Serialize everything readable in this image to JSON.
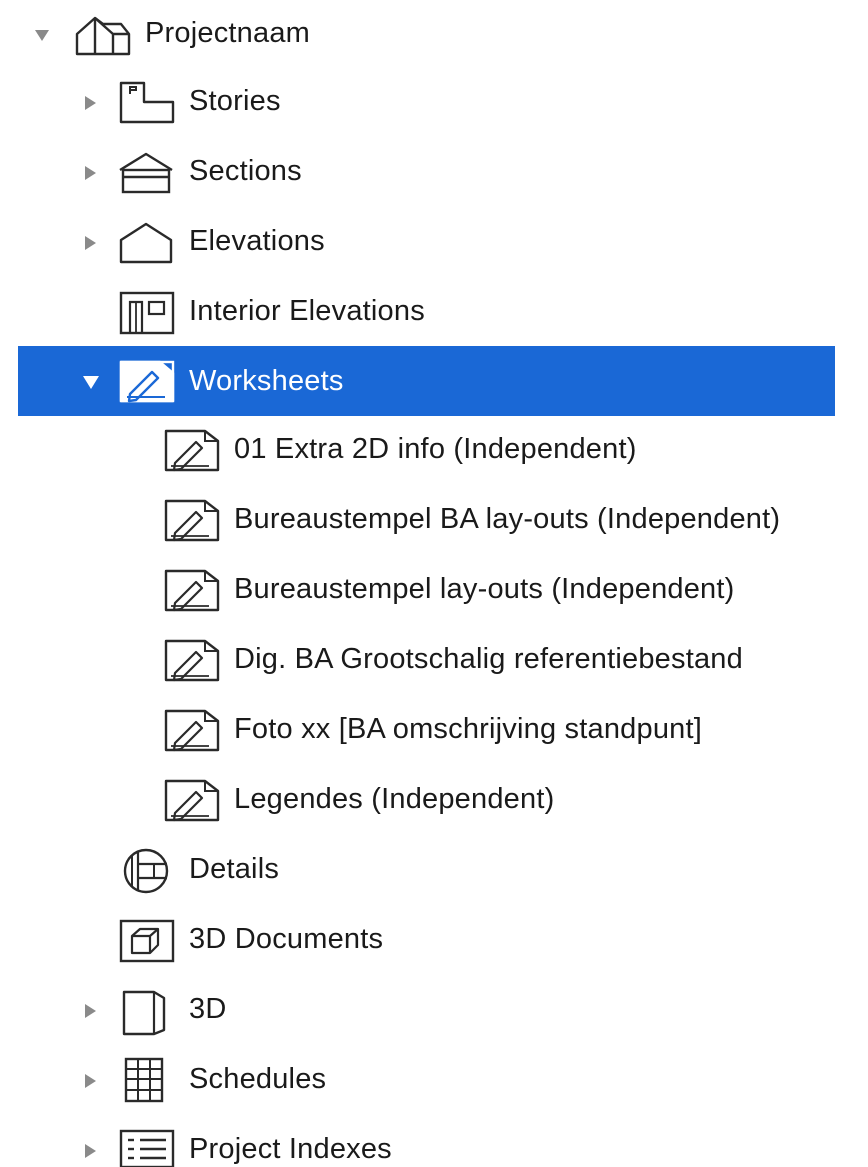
{
  "tree": {
    "root": {
      "label": "Projectnaam",
      "icon": "project-house-icon",
      "expanded": true
    },
    "items": [
      {
        "label": "Stories",
        "icon": "stories-icon",
        "disclosure": "collapsed"
      },
      {
        "label": "Sections",
        "icon": "sections-icon",
        "disclosure": "collapsed"
      },
      {
        "label": "Elevations",
        "icon": "elevations-icon",
        "disclosure": "collapsed"
      },
      {
        "label": "Interior Elevations",
        "icon": "interior-elevations-icon",
        "disclosure": "none"
      },
      {
        "label": "Worksheets",
        "icon": "worksheet-icon",
        "disclosure": "expanded",
        "selected": true
      },
      {
        "label": "Details",
        "icon": "details-icon",
        "disclosure": "none"
      },
      {
        "label": "3D Documents",
        "icon": "3d-documents-icon",
        "disclosure": "none"
      },
      {
        "label": "3D",
        "icon": "3d-icon",
        "disclosure": "collapsed"
      },
      {
        "label": "Schedules",
        "icon": "schedules-icon",
        "disclosure": "collapsed"
      },
      {
        "label": "Project Indexes",
        "icon": "project-indexes-icon",
        "disclosure": "collapsed"
      }
    ],
    "worksheets": [
      {
        "label": "01 Extra 2D info (Independent)",
        "icon": "worksheet-icon"
      },
      {
        "label": "Bureaustempel BA lay-outs (Independent)",
        "icon": "worksheet-icon"
      },
      {
        "label": "Bureaustempel lay-outs (Independent)",
        "icon": "worksheet-icon"
      },
      {
        "label": "Dig. BA Grootschalig referentiebestand",
        "icon": "worksheet-icon"
      },
      {
        "label": "Foto xx [BA omschrijving standpunt]",
        "icon": "worksheet-icon"
      },
      {
        "label": "Legendes (Independent)",
        "icon": "worksheet-icon"
      }
    ]
  },
  "colors": {
    "selection": "#1a68d6",
    "disclosure": "#8a8a8a",
    "icon_stroke": "#2a2a2a"
  }
}
